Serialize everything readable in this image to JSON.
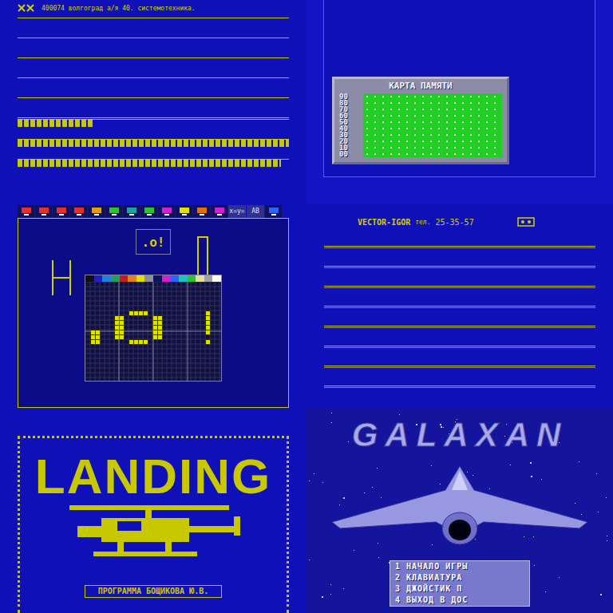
{
  "letterhead": {
    "address": "400074 волгоград а/я 40. системотехника.",
    "bars": [
      {
        "level": 0.28
      },
      {
        "level": 1
      },
      {
        "level": 0.97
      }
    ]
  },
  "memory_map": {
    "title": "КАРТА ПАМЯТИ",
    "rows": [
      "90",
      "80",
      "70",
      "60",
      "50",
      "40",
      "30",
      "20",
      "10",
      "00"
    ]
  },
  "paint": {
    "tools": [
      {
        "kind": "icon",
        "color": "#e03030"
      },
      {
        "kind": "icon",
        "color": "#e03030"
      },
      {
        "kind": "icon",
        "color": "#e03030"
      },
      {
        "kind": "icon",
        "color": "#e03030"
      },
      {
        "kind": "icon",
        "color": "#e0a000"
      },
      {
        "kind": "icon",
        "color": "#30c030"
      },
      {
        "kind": "icon",
        "color": "#20a0a0"
      },
      {
        "kind": "icon",
        "color": "#30c030"
      },
      {
        "kind": "icon",
        "color": "#d020d0"
      },
      {
        "kind": "icon",
        "color": "#e0e000"
      },
      {
        "kind": "icon",
        "color": "#e07000"
      },
      {
        "kind": "icon",
        "color": "#d020d0"
      },
      {
        "kind": "text",
        "label": "x=y="
      },
      {
        "kind": "text",
        "label": "AB"
      },
      {
        "kind": "icon",
        "color": "#3060ff"
      }
    ],
    "palette": [
      "#101010",
      "#2020c0",
      "#2080e0",
      "#20a060",
      "#c02020",
      "#e08020",
      "#e0e000",
      "#909090",
      "#101060",
      "#d020d0",
      "#3060ff",
      "#20c0c0",
      "#30c030",
      "#e0e0a0",
      "#a0a0a0",
      "#ffffff"
    ],
    "preview_text": ".o!"
  },
  "vector_igor": {
    "name": "VECTOR-IGOR",
    "phone_label": "тел.",
    "phone": "25-35-57"
  },
  "landing": {
    "title": "LANDING",
    "credit": "ПРОГРАММА БОЩИКОВА Ю.В."
  },
  "galaxan": {
    "title": "GALAXAN",
    "menu": [
      "1 НАЧАЛО ИГРЫ",
      "2 КЛАВИАТУРА",
      "3 ДЖОЙСТИК П",
      "4 ВЫХОД В ДОС"
    ]
  }
}
